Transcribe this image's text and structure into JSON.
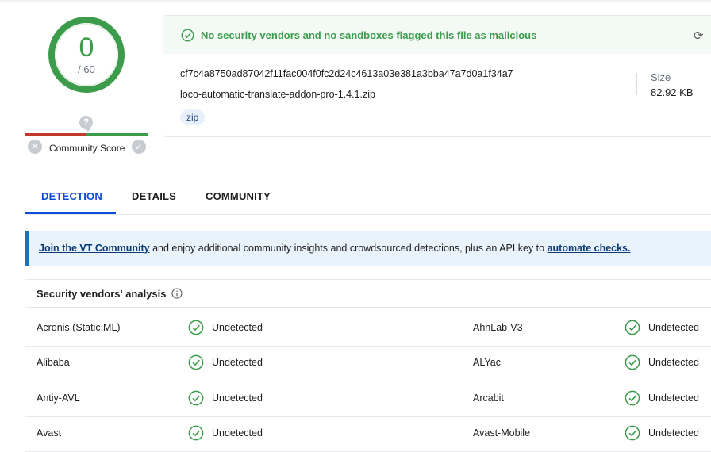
{
  "score": {
    "detections": "0",
    "total": "/ 60"
  },
  "community": {
    "label": "Community Score",
    "question_glyph": "?",
    "negative_glyph": "✕",
    "positive_glyph": "✓"
  },
  "summary": {
    "status_text": "No security vendors and no sandboxes flagged this file as malicious",
    "reanalyze_glyph": "⟳",
    "hash": "cf7c4a8750ad87042f11fac004f0fc2d24c4613a03e381a3bba47a7d0a1f34a7",
    "filename": "loco-automatic-translate-addon-pro-1.4.1.zip",
    "tag": "zip",
    "size_label": "Size",
    "size_value": "82.92 KB"
  },
  "tabs": [
    "DETECTION",
    "DETAILS",
    "COMMUNITY"
  ],
  "banner": {
    "link1": "Join the VT Community",
    "middle": " and enjoy additional community insights and crowdsourced detections, plus an API key to ",
    "link2": "automate checks."
  },
  "vendors_title": "Security vendors' analysis",
  "vendors": [
    {
      "left": {
        "name": "Acronis (Static ML)",
        "result": "Undetected"
      },
      "right": {
        "name": "AhnLab-V3",
        "result": "Undetected"
      }
    },
    {
      "left": {
        "name": "Alibaba",
        "result": "Undetected"
      },
      "right": {
        "name": "ALYac",
        "result": "Undetected"
      }
    },
    {
      "left": {
        "name": "Antiy-AVL",
        "result": "Undetected"
      },
      "right": {
        "name": "Arcabit",
        "result": "Undetected"
      }
    },
    {
      "left": {
        "name": "Avast",
        "result": "Undetected"
      },
      "right": {
        "name": "Avast-Mobile",
        "result": "Undetected"
      }
    }
  ],
  "colors": {
    "clean": "#3c9c4c",
    "accent": "#0b4dda",
    "link": "#0b3a75"
  }
}
